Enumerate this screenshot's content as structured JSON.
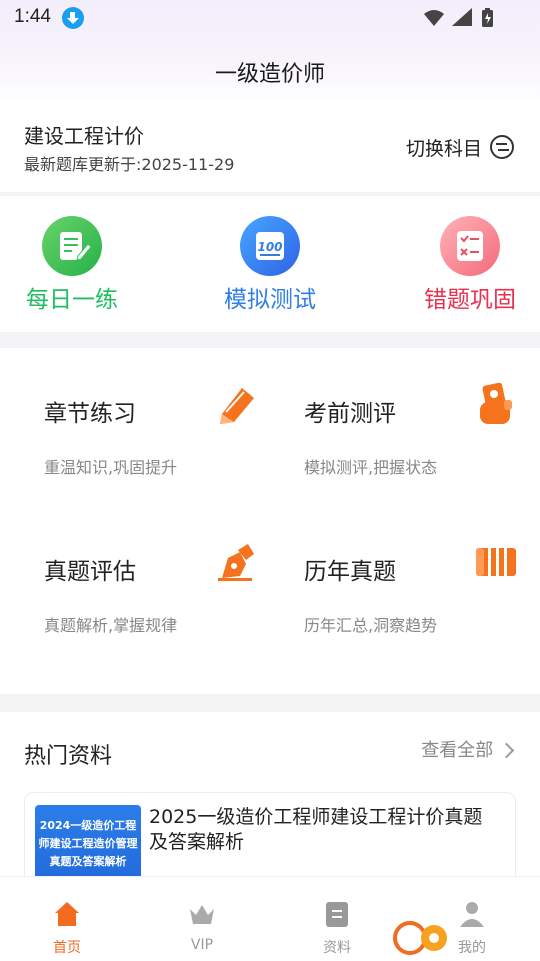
{
  "status_bar": {
    "time": "1:44"
  },
  "header": {
    "title": "一级造价师"
  },
  "subject": {
    "name": "建设工程计价",
    "updated": "最新题库更新于:2025-11-29",
    "switch_label": "切换科目"
  },
  "quick_actions": [
    {
      "label": "每日一练",
      "color": "#1ebf62"
    },
    {
      "label": "模拟测试",
      "color": "#2f7fe6"
    },
    {
      "label": "错题巩固",
      "color": "#e8304f"
    }
  ],
  "modules": [
    {
      "title": "章节练习",
      "subtitle": "重温知识,巩固提升"
    },
    {
      "title": "考前测评",
      "subtitle": "模拟测评,把握状态"
    },
    {
      "title": "真题评估",
      "subtitle": "真题解析,掌握规律"
    },
    {
      "title": "历年真题",
      "subtitle": "历年汇总,洞察趋势"
    }
  ],
  "hot": {
    "title": "热门资料",
    "more": "查看全部",
    "card": {
      "cover_text": "2024一级造价工程师建设工程造价管理真题及答案解析",
      "title": "2025一级造价工程师建设工程计价真题及答案解析"
    }
  },
  "tabbar": [
    {
      "label": "首页",
      "active": true
    },
    {
      "label": "VIP",
      "active": false
    },
    {
      "label": "资料",
      "active": false
    },
    {
      "label": "我的",
      "active": false
    }
  ],
  "colors": {
    "accent": "#f26b21",
    "icon_orange": "#f5731d"
  }
}
